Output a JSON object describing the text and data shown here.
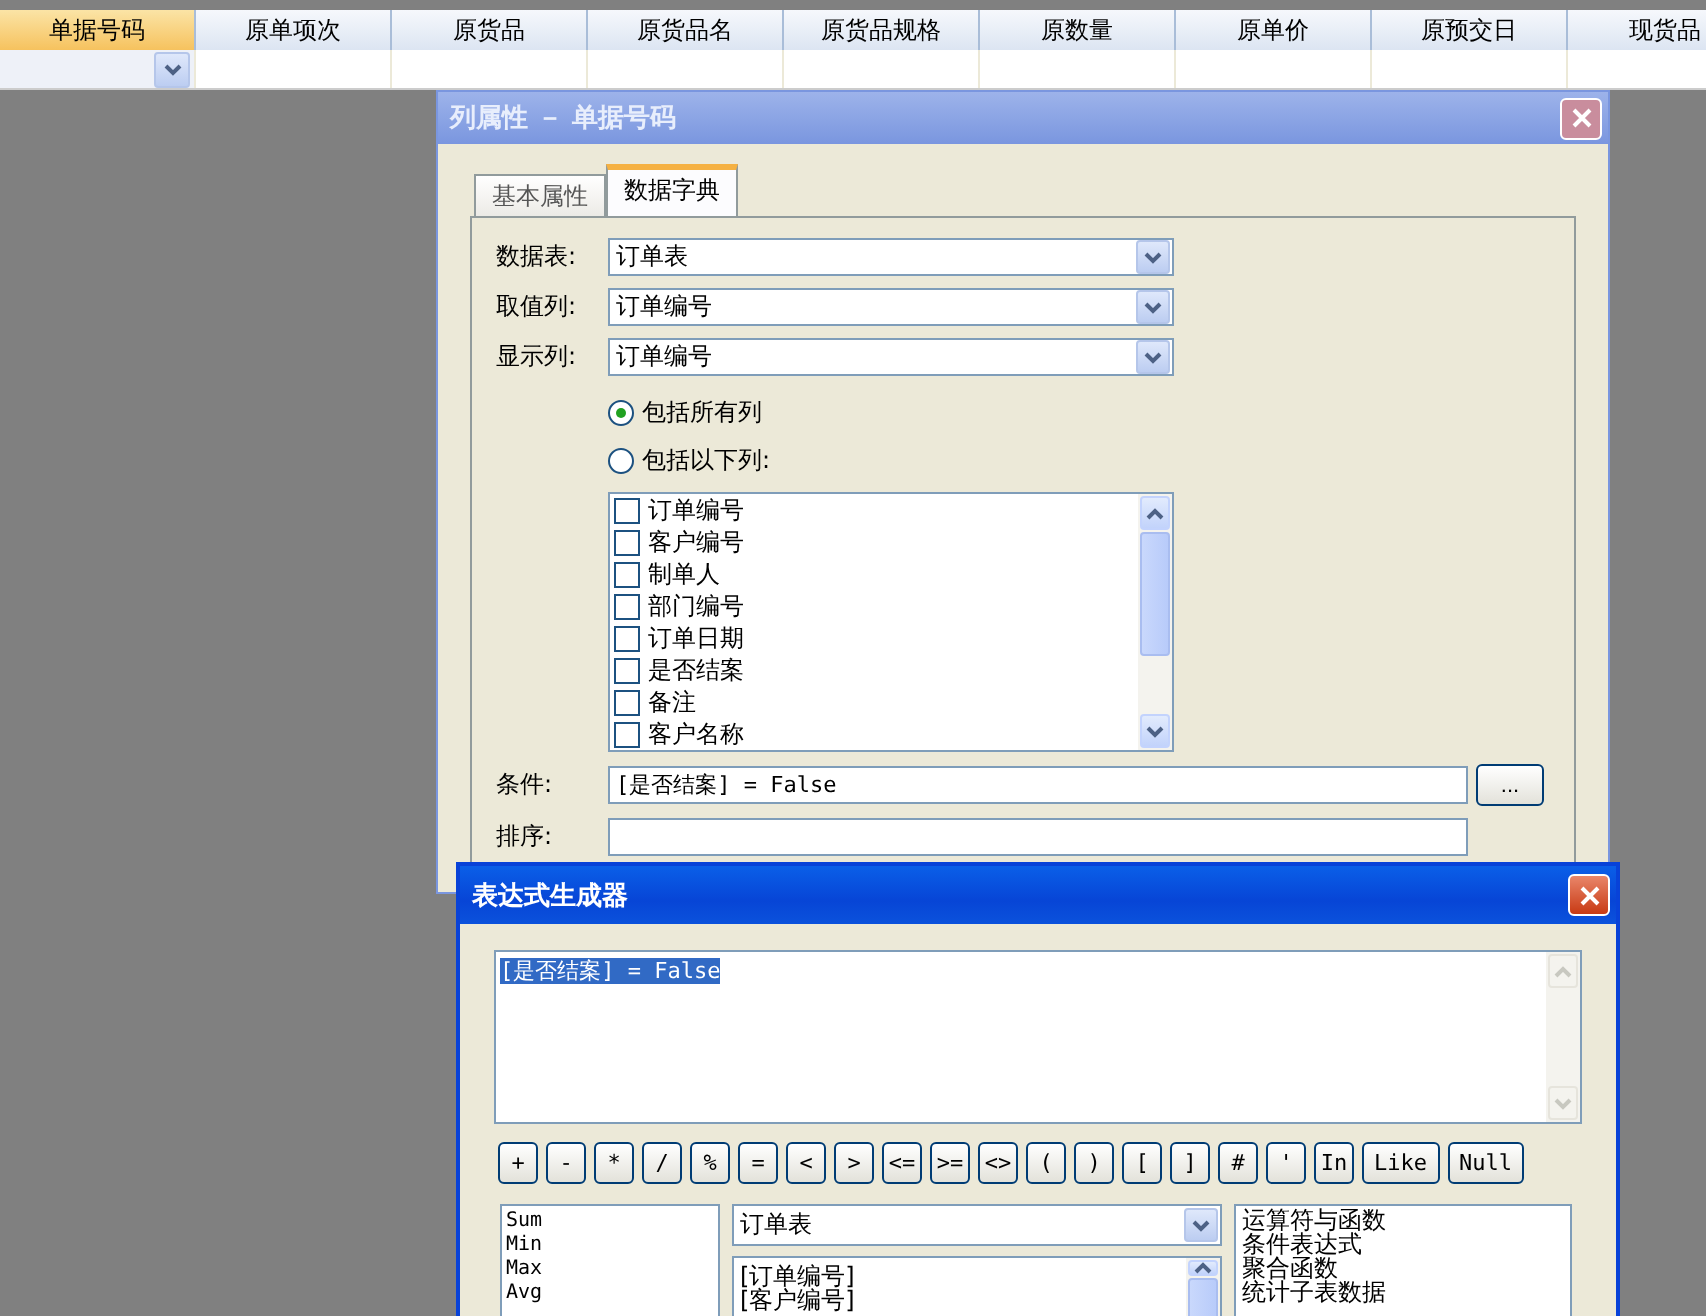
{
  "grid": {
    "columns": [
      {
        "label": "单据号码",
        "selected": true
      },
      {
        "label": "原单项次",
        "selected": false
      },
      {
        "label": "原货品",
        "selected": false
      },
      {
        "label": "原货品名",
        "selected": false
      },
      {
        "label": "原货品规格",
        "selected": false
      },
      {
        "label": "原数量",
        "selected": false
      },
      {
        "label": "原单价",
        "selected": false
      },
      {
        "label": "原预交日",
        "selected": false
      },
      {
        "label": "现货品",
        "selected": false
      }
    ]
  },
  "column_properties_dialog": {
    "title": "列属性 － 单据号码",
    "tabs": [
      {
        "label": "基本属性",
        "selected": false
      },
      {
        "label": "数据字典",
        "selected": true
      }
    ],
    "dropdowns": [
      {
        "label": "数据表:",
        "value": "订单表"
      },
      {
        "label": "取值列:",
        "value": "订单编号"
      },
      {
        "label": "显示列:",
        "value": "订单编号"
      }
    ],
    "radios": [
      {
        "label": "包括所有列",
        "selected": true
      },
      {
        "label": "包括以下列:",
        "selected": false
      }
    ],
    "columns_list": [
      {
        "label": "订单编号",
        "checked": false
      },
      {
        "label": "客户编号",
        "checked": false
      },
      {
        "label": "制单人",
        "checked": false
      },
      {
        "label": "部门编号",
        "checked": false
      },
      {
        "label": "订单日期",
        "checked": false
      },
      {
        "label": "是否结案",
        "checked": false
      },
      {
        "label": "备注",
        "checked": false
      },
      {
        "label": "客户名称",
        "checked": false
      }
    ],
    "condition": {
      "label": "条件:",
      "value": "[是否结案] = False",
      "button": "..."
    },
    "sort": {
      "label": "排序:"
    }
  },
  "expression_builder": {
    "title": "表达式生成器",
    "expression": {
      "value": "[是否结案] = False",
      "text_selected": true
    },
    "operator_buttons": [
      "+",
      "-",
      "*",
      "/",
      "%",
      "=",
      "<",
      ">",
      "<=",
      ">=",
      "<>",
      "(",
      ")",
      "[",
      "]",
      "#",
      "'",
      "In",
      "Like",
      "Null"
    ],
    "functions": [
      "Sum",
      "Min",
      "Max",
      "Avg"
    ],
    "table_dropdown": {
      "value": "订单表"
    },
    "fields": [
      "[订单编号]",
      "[客户编号]"
    ],
    "categories": [
      "运算符与函数",
      "条件表达式",
      "聚合函数",
      "统计子表数据"
    ]
  }
}
